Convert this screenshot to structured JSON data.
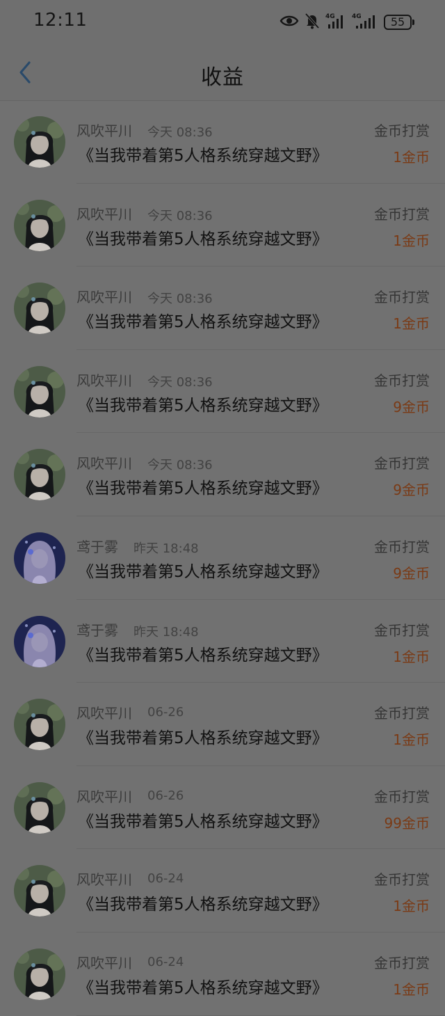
{
  "status_bar": {
    "time": "12:11",
    "battery": "55",
    "icons": [
      "eye-icon",
      "bell-muted-icon",
      "signal-4g-icon",
      "signal-4g-icon"
    ]
  },
  "header": {
    "title": "收益",
    "back_icon": "chevron-left-icon"
  },
  "colors": {
    "accent_amount": "#7a3a15",
    "back_arrow": "#2a4a6a"
  },
  "records": [
    {
      "user": "风吹平川",
      "time": "今天 08:36",
      "book": "《当我带着第5人格系统穿越文野》",
      "type": "金币打赏",
      "amount": "1金币",
      "avatar": "avatar-green"
    },
    {
      "user": "风吹平川",
      "time": "今天 08:36",
      "book": "《当我带着第5人格系统穿越文野》",
      "type": "金币打赏",
      "amount": "1金币",
      "avatar": "avatar-green"
    },
    {
      "user": "风吹平川",
      "time": "今天 08:36",
      "book": "《当我带着第5人格系统穿越文野》",
      "type": "金币打赏",
      "amount": "1金币",
      "avatar": "avatar-green"
    },
    {
      "user": "风吹平川",
      "time": "今天 08:36",
      "book": "《当我带着第5人格系统穿越文野》",
      "type": "金币打赏",
      "amount": "9金币",
      "avatar": "avatar-green"
    },
    {
      "user": "风吹平川",
      "time": "今天 08:36",
      "book": "《当我带着第5人格系统穿越文野》",
      "type": "金币打赏",
      "amount": "9金币",
      "avatar": "avatar-green"
    },
    {
      "user": "鸢于雾",
      "time": "昨天 18:48",
      "book": "《当我带着第5人格系统穿越文野》",
      "type": "金币打赏",
      "amount": "9金币",
      "avatar": "avatar-purple"
    },
    {
      "user": "鸢于雾",
      "time": "昨天 18:48",
      "book": "《当我带着第5人格系统穿越文野》",
      "type": "金币打赏",
      "amount": "1金币",
      "avatar": "avatar-purple"
    },
    {
      "user": "风吹平川",
      "time": "06-26",
      "book": "《当我带着第5人格系统穿越文野》",
      "type": "金币打赏",
      "amount": "1金币",
      "avatar": "avatar-green"
    },
    {
      "user": "风吹平川",
      "time": "06-26",
      "book": "《当我带着第5人格系统穿越文野》",
      "type": "金币打赏",
      "amount": "99金币",
      "avatar": "avatar-green"
    },
    {
      "user": "风吹平川",
      "time": "06-24",
      "book": "《当我带着第5人格系统穿越文野》",
      "type": "金币打赏",
      "amount": "1金币",
      "avatar": "avatar-green"
    },
    {
      "user": "风吹平川",
      "time": "06-24",
      "book": "《当我带着第5人格系统穿越文野》",
      "type": "金币打赏",
      "amount": "1金币",
      "avatar": "avatar-green"
    }
  ]
}
